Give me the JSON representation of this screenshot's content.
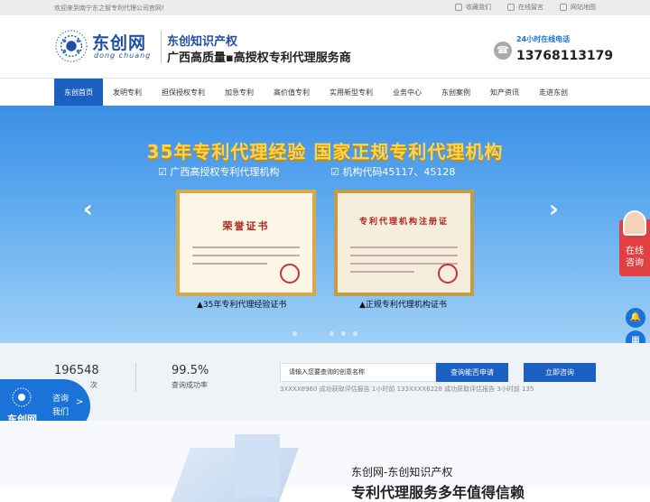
{
  "topbar": {
    "welcome": "欢迎来到南宁东之智专利代理公司官网!",
    "links": [
      {
        "label": "收藏我们",
        "icon": "star-icon"
      },
      {
        "label": "在线留言",
        "icon": "message-icon"
      },
      {
        "label": "网站地图",
        "icon": "sitemap-icon"
      }
    ]
  },
  "header": {
    "logo_cn": "东创网",
    "logo_py": "dong chuang",
    "slogan1": "东创知识产权",
    "slogan2": "广西高质量▪高授权专利代理服务商",
    "phone_label": "24小时在线电话",
    "phone_number": "13768113179"
  },
  "nav": {
    "items": [
      "东创首页",
      "发明专利",
      "担保授权专利",
      "加急专利",
      "高价值专利",
      "实用新型专利",
      "业务中心",
      "东创案例",
      "知产资讯",
      "走进东创"
    ],
    "active_index": 0
  },
  "banner": {
    "title": "35年专利代理经验   国家正规专利代理机构",
    "sub1": "☑ 广西高授权专利代理机构",
    "sub2": "☑ 机构代码45117、45128",
    "cert1_title": "荣誉证书",
    "cert2_title": "专利代理机构注册证",
    "cap1": "▲35年专利代理经验证书",
    "cap2": "▲正规专利代理机构证书",
    "arrow_left": "‹",
    "arrow_right": "›",
    "slide_count": 4,
    "active_slide": 1
  },
  "float_chat": {
    "line1": "在线",
    "line2": "咨询"
  },
  "stats": {
    "num1": "196548",
    "lbl1": "次",
    "num2": "99.5%",
    "lbl2": "查询成功率",
    "search_placeholder": "请输入您要查询的创意名称",
    "btn_apply": "查询能否申请",
    "btn_consult": "立即咨询",
    "ticker": "3XXXX8960 成功获取评估报告          1小时前 133XXXX6228 成功获取评估报告          3小时前 135"
  },
  "consult": {
    "name": "东创网",
    "line1": "咨询",
    "line2": "我们",
    "chev": ">"
  },
  "intro": {
    "title": "东创网-东创知识产权",
    "subtitle": "专利代理服务多年值得信赖"
  }
}
